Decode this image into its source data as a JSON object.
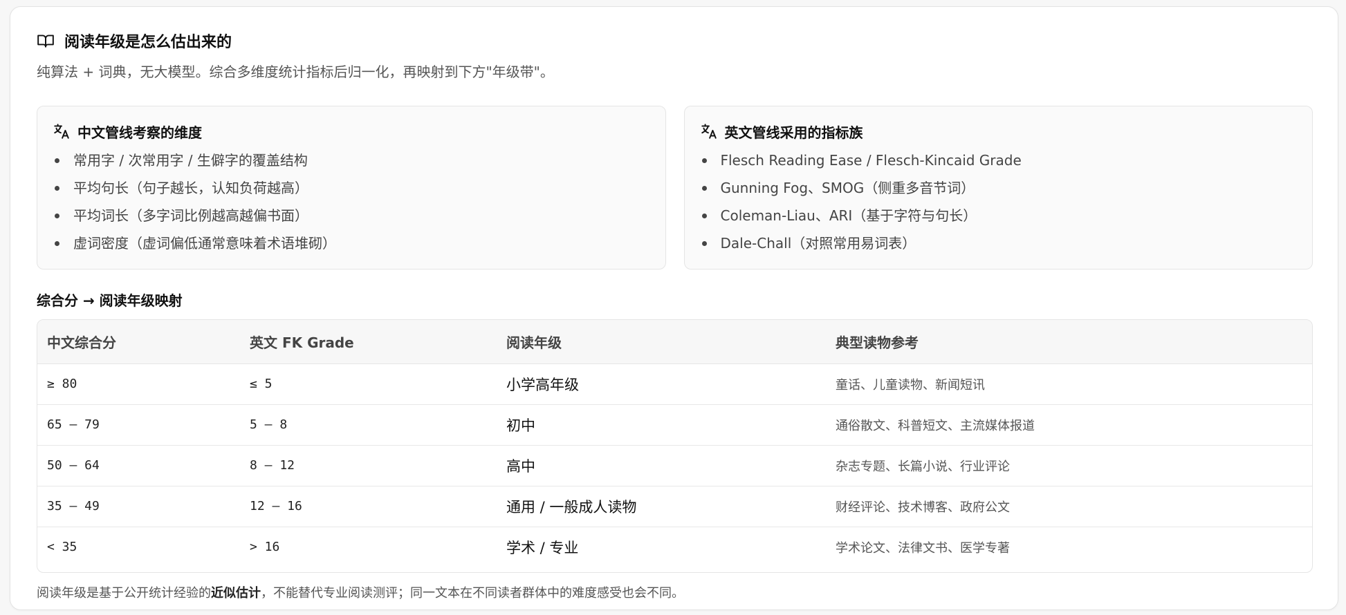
{
  "header": {
    "title": "阅读年级是怎么估出来的",
    "subtitle": "纯算法 + 词典，无大模型。综合多维度统计指标后归一化，再映射到下方\"年级带\"。"
  },
  "panels": {
    "zh": {
      "title": "中文管线考察的维度",
      "items": [
        "常用字 / 次常用字 / 生僻字的覆盖结构",
        "平均句长（句子越长，认知负荷越高）",
        "平均词长（多字词比例越高越偏书面）",
        "虚词密度（虚词偏低通常意味着术语堆砌）"
      ]
    },
    "en": {
      "title": "英文管线采用的指标族",
      "items": [
        "Flesch Reading Ease / Flesch-Kincaid Grade",
        "Gunning Fog、SMOG（侧重多音节词）",
        "Coleman-Liau、ARI（基于字符与句长）",
        "Dale-Chall（对照常用易词表）"
      ]
    }
  },
  "mapping": {
    "title": "综合分 → 阅读年级映射",
    "headers": [
      "中文综合分",
      "英文 FK Grade",
      "阅读年级",
      "典型读物参考"
    ],
    "rows": [
      [
        "≥ 80",
        "≤ 5",
        "小学高年级",
        "童话、儿童读物、新闻短讯"
      ],
      [
        "65 – 79",
        "5 – 8",
        "初中",
        "通俗散文、科普短文、主流媒体报道"
      ],
      [
        "50 – 64",
        "8 – 12",
        "高中",
        "杂志专题、长篇小说、行业评论"
      ],
      [
        "35 – 49",
        "12 – 16",
        "通用 / 一般成人读物",
        "财经评论、技术博客、政府公文"
      ],
      [
        "< 35",
        "> 16",
        "学术 / 专业",
        "学术论文、法律文书、医学专著"
      ]
    ]
  },
  "footnote": {
    "pre": "阅读年级是基于公开统计经验的",
    "bold": "近似估计",
    "post": "，不能替代专业阅读测评；同一文本在不同读者群体中的难度感受也会不同。"
  },
  "icons": {
    "title": "book-open-icon",
    "panel": "translate-icon"
  }
}
